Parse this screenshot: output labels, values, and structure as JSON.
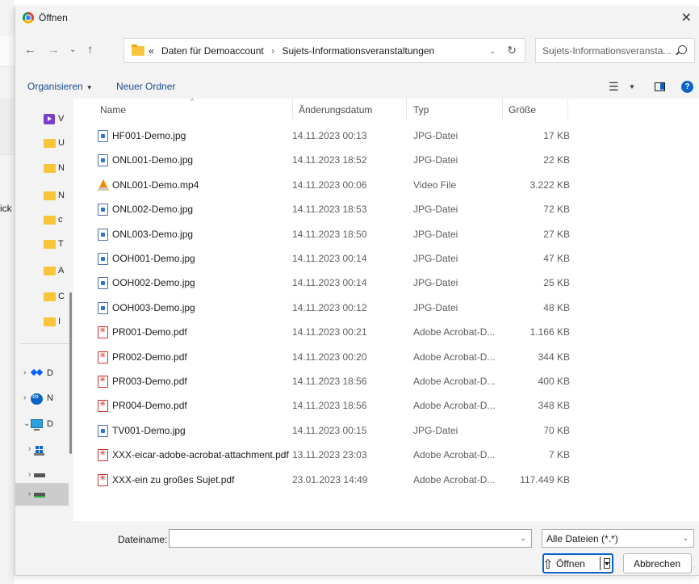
{
  "background": {
    "partial_text": "ick"
  },
  "dialog": {
    "title": "Öffnen",
    "close_symbol": "✕",
    "address": {
      "overflow": "«",
      "crumbs": [
        "Daten für Demoaccount",
        "Sujets-Informationsveranstaltungen"
      ],
      "separator": "›"
    },
    "search": {
      "placeholder": "Sujets-Informationsveransta..."
    },
    "toolbar": {
      "organize": "Organisieren",
      "new_folder": "Neuer Ordner",
      "help": "?"
    },
    "nav_pane": {
      "letters": [
        "V",
        "U",
        "N",
        "N",
        "c",
        "T",
        "A",
        "C",
        "I"
      ],
      "tree_letters": [
        "D",
        "N",
        "D"
      ]
    },
    "columns": {
      "name": "Name",
      "date": "Änderungsdatum",
      "type": "Typ",
      "size": "Größe"
    },
    "files": [
      {
        "name": "HF001-Demo.jpg",
        "date": "14.11.2023 00:13",
        "type": "JPG-Datei",
        "size": "17 KB",
        "icon": "jpg-icon"
      },
      {
        "name": "ONL001-Demo.jpg",
        "date": "14.11.2023 18:52",
        "type": "JPG-Datei",
        "size": "22 KB",
        "icon": "jpg-icon"
      },
      {
        "name": "ONL001-Demo.mp4",
        "date": "14.11.2023 00:06",
        "type": "Video File",
        "size": "3.222 KB",
        "icon": "vlc-icon"
      },
      {
        "name": "ONL002-Demo.jpg",
        "date": "14.11.2023 18:53",
        "type": "JPG-Datei",
        "size": "72 KB",
        "icon": "jpg-icon"
      },
      {
        "name": "ONL003-Demo.jpg",
        "date": "14.11.2023 18:50",
        "type": "JPG-Datei",
        "size": "27 KB",
        "icon": "jpg-icon"
      },
      {
        "name": "OOH001-Demo.jpg",
        "date": "14.11.2023 00:14",
        "type": "JPG-Datei",
        "size": "47 KB",
        "icon": "jpg-icon"
      },
      {
        "name": "OOH002-Demo.jpg",
        "date": "14.11.2023 00:14",
        "type": "JPG-Datei",
        "size": "25 KB",
        "icon": "jpg-icon"
      },
      {
        "name": "OOH003-Demo.jpg",
        "date": "14.11.2023 00:12",
        "type": "JPG-Datei",
        "size": "48 KB",
        "icon": "jpg-icon"
      },
      {
        "name": "PR001-Demo.pdf",
        "date": "14.11.2023 00:21",
        "type": "Adobe Acrobat-D...",
        "size": "1.166 KB",
        "icon": "pdf-icon"
      },
      {
        "name": "PR002-Demo.pdf",
        "date": "14.11.2023 00:20",
        "type": "Adobe Acrobat-D...",
        "size": "344 KB",
        "icon": "pdf-icon"
      },
      {
        "name": "PR003-Demo.pdf",
        "date": "14.11.2023 18:56",
        "type": "Adobe Acrobat-D...",
        "size": "400 KB",
        "icon": "pdf-icon"
      },
      {
        "name": "PR004-Demo.pdf",
        "date": "14.11.2023 18:56",
        "type": "Adobe Acrobat-D...",
        "size": "348 KB",
        "icon": "pdf-icon"
      },
      {
        "name": "TV001-Demo.jpg",
        "date": "14.11.2023 00:15",
        "type": "JPG-Datei",
        "size": "70 KB",
        "icon": "jpg-icon"
      },
      {
        "name": "XXX-eicar-adobe-acrobat-attachment.pdf",
        "date": "13.11.2023 23:03",
        "type": "Adobe Acrobat-D...",
        "size": "7 KB",
        "icon": "pdf-icon"
      },
      {
        "name": "XXX-ein zu großes Sujet.pdf",
        "date": "23.01.2023 14:49",
        "type": "Adobe Acrobat-D...",
        "size": "117.449 KB",
        "icon": "pdf-icon"
      }
    ],
    "footer": {
      "filename_label": "Dateiname:",
      "filename_value": "",
      "filter_value": "Alle Dateien (*.*)",
      "open_label": "Öffnen",
      "cancel_label": "Abbrechen"
    }
  },
  "colors": {
    "accent": "#0a64c8",
    "folder": "#f8c43a",
    "pdf": "#d32a22",
    "chrome_bg": "#f3f3f3"
  }
}
